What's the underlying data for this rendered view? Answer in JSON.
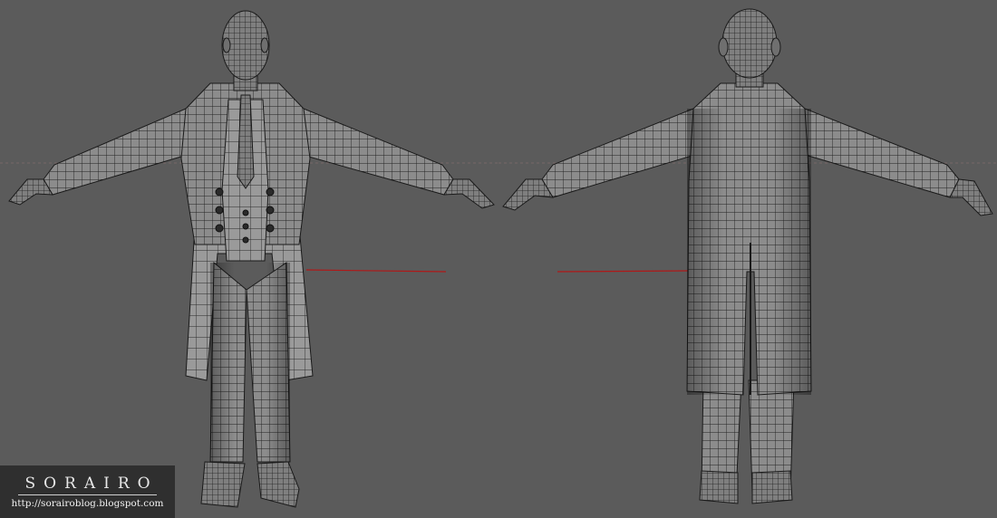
{
  "scene": {
    "background_color": "#5b5b5b",
    "mesh_color": "#8c8c8c",
    "wire_color": "#1e1e1e",
    "guide_color": "#b01818",
    "views": [
      "front",
      "back"
    ]
  },
  "watermark": {
    "title": "SORAIRO",
    "url": "http://sorairoblog.blogspot.com"
  }
}
